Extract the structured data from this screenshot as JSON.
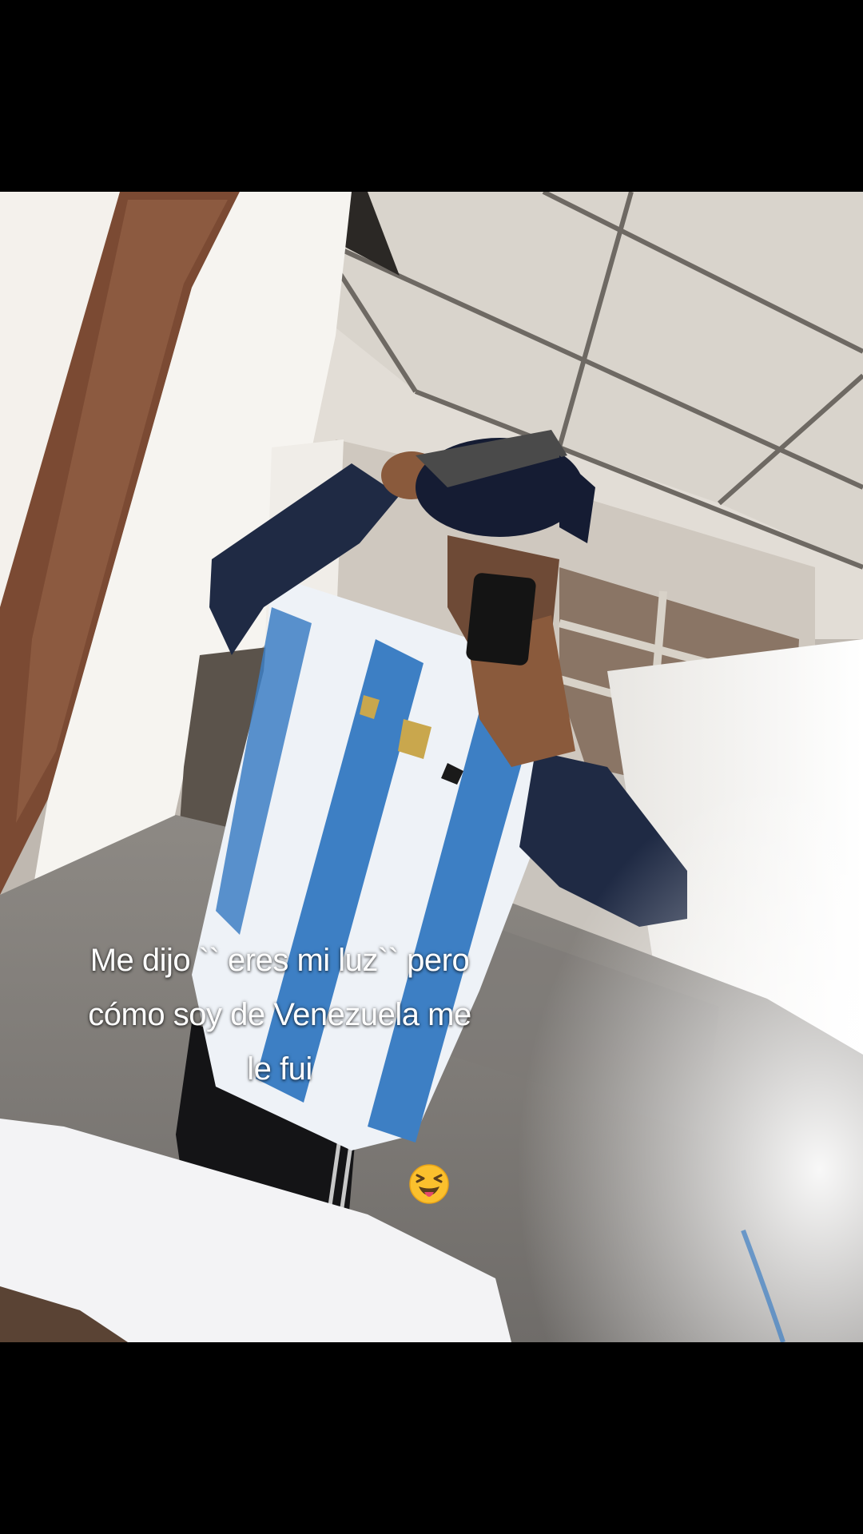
{
  "video": {
    "caption_lines": [
      "Me dijo `` eres mi luz`` pero",
      "cómo soy de Venezuela me",
      "le fui"
    ],
    "emoji": "squinting-face-with-tongue",
    "colors": {
      "letterbox": "#000000",
      "caption_text": "#ffffff",
      "jersey_blue": "#3d7fc4",
      "jersey_white": "#eef2f7",
      "sleeve_navy": "#1f2a44"
    }
  }
}
